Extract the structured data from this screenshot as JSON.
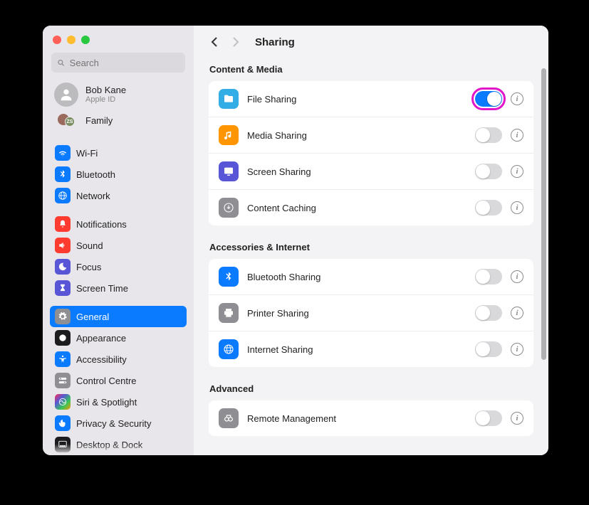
{
  "window": {
    "title": "Sharing"
  },
  "search": {
    "placeholder": "Search"
  },
  "user": {
    "name": "Bob Kane",
    "sub": "Apple ID",
    "family": "Family",
    "family_badge": "ZS"
  },
  "sidebar": {
    "g1": [
      {
        "label": "Wi-Fi",
        "icon": "wifi",
        "color": "blue"
      },
      {
        "label": "Bluetooth",
        "icon": "bluetooth",
        "color": "blue"
      },
      {
        "label": "Network",
        "icon": "network",
        "color": "blue"
      }
    ],
    "g2": [
      {
        "label": "Notifications",
        "icon": "bell",
        "color": "red"
      },
      {
        "label": "Sound",
        "icon": "sound",
        "color": "red"
      },
      {
        "label": "Focus",
        "icon": "moon",
        "color": "purple"
      },
      {
        "label": "Screen Time",
        "icon": "hourglass",
        "color": "purple"
      }
    ],
    "g3": [
      {
        "label": "General",
        "icon": "gear",
        "color": "gray",
        "selected": true
      },
      {
        "label": "Appearance",
        "icon": "appearance",
        "color": "black"
      },
      {
        "label": "Accessibility",
        "icon": "accessibility",
        "color": "blue"
      },
      {
        "label": "Control Centre",
        "icon": "switches",
        "color": "gray"
      },
      {
        "label": "Siri & Spotlight",
        "icon": "siri",
        "color": "grad"
      },
      {
        "label": "Privacy & Security",
        "icon": "hand",
        "color": "blue"
      },
      {
        "label": "Desktop & Dock",
        "icon": "dock",
        "color": "black"
      }
    ]
  },
  "sections": [
    {
      "title": "Content & Media",
      "items": [
        {
          "label": "File Sharing",
          "icon": "folder",
          "color": "#32ade6",
          "on": true,
          "highlighted": true
        },
        {
          "label": "Media Sharing",
          "icon": "music",
          "color": "#ff9500",
          "on": false
        },
        {
          "label": "Screen Sharing",
          "icon": "screen",
          "color": "#5856d6",
          "on": false
        },
        {
          "label": "Content Caching",
          "icon": "download",
          "color": "#8e8e93",
          "on": false
        }
      ]
    },
    {
      "title": "Accessories & Internet",
      "items": [
        {
          "label": "Bluetooth Sharing",
          "icon": "bluetooth",
          "color": "#0a7aff",
          "on": false
        },
        {
          "label": "Printer Sharing",
          "icon": "printer",
          "color": "#8e8e93",
          "on": false
        },
        {
          "label": "Internet Sharing",
          "icon": "globe",
          "color": "#0a7aff",
          "on": false
        }
      ]
    },
    {
      "title": "Advanced",
      "items": [
        {
          "label": "Remote Management",
          "icon": "binoc",
          "color": "#8e8e93",
          "on": false
        }
      ]
    }
  ]
}
